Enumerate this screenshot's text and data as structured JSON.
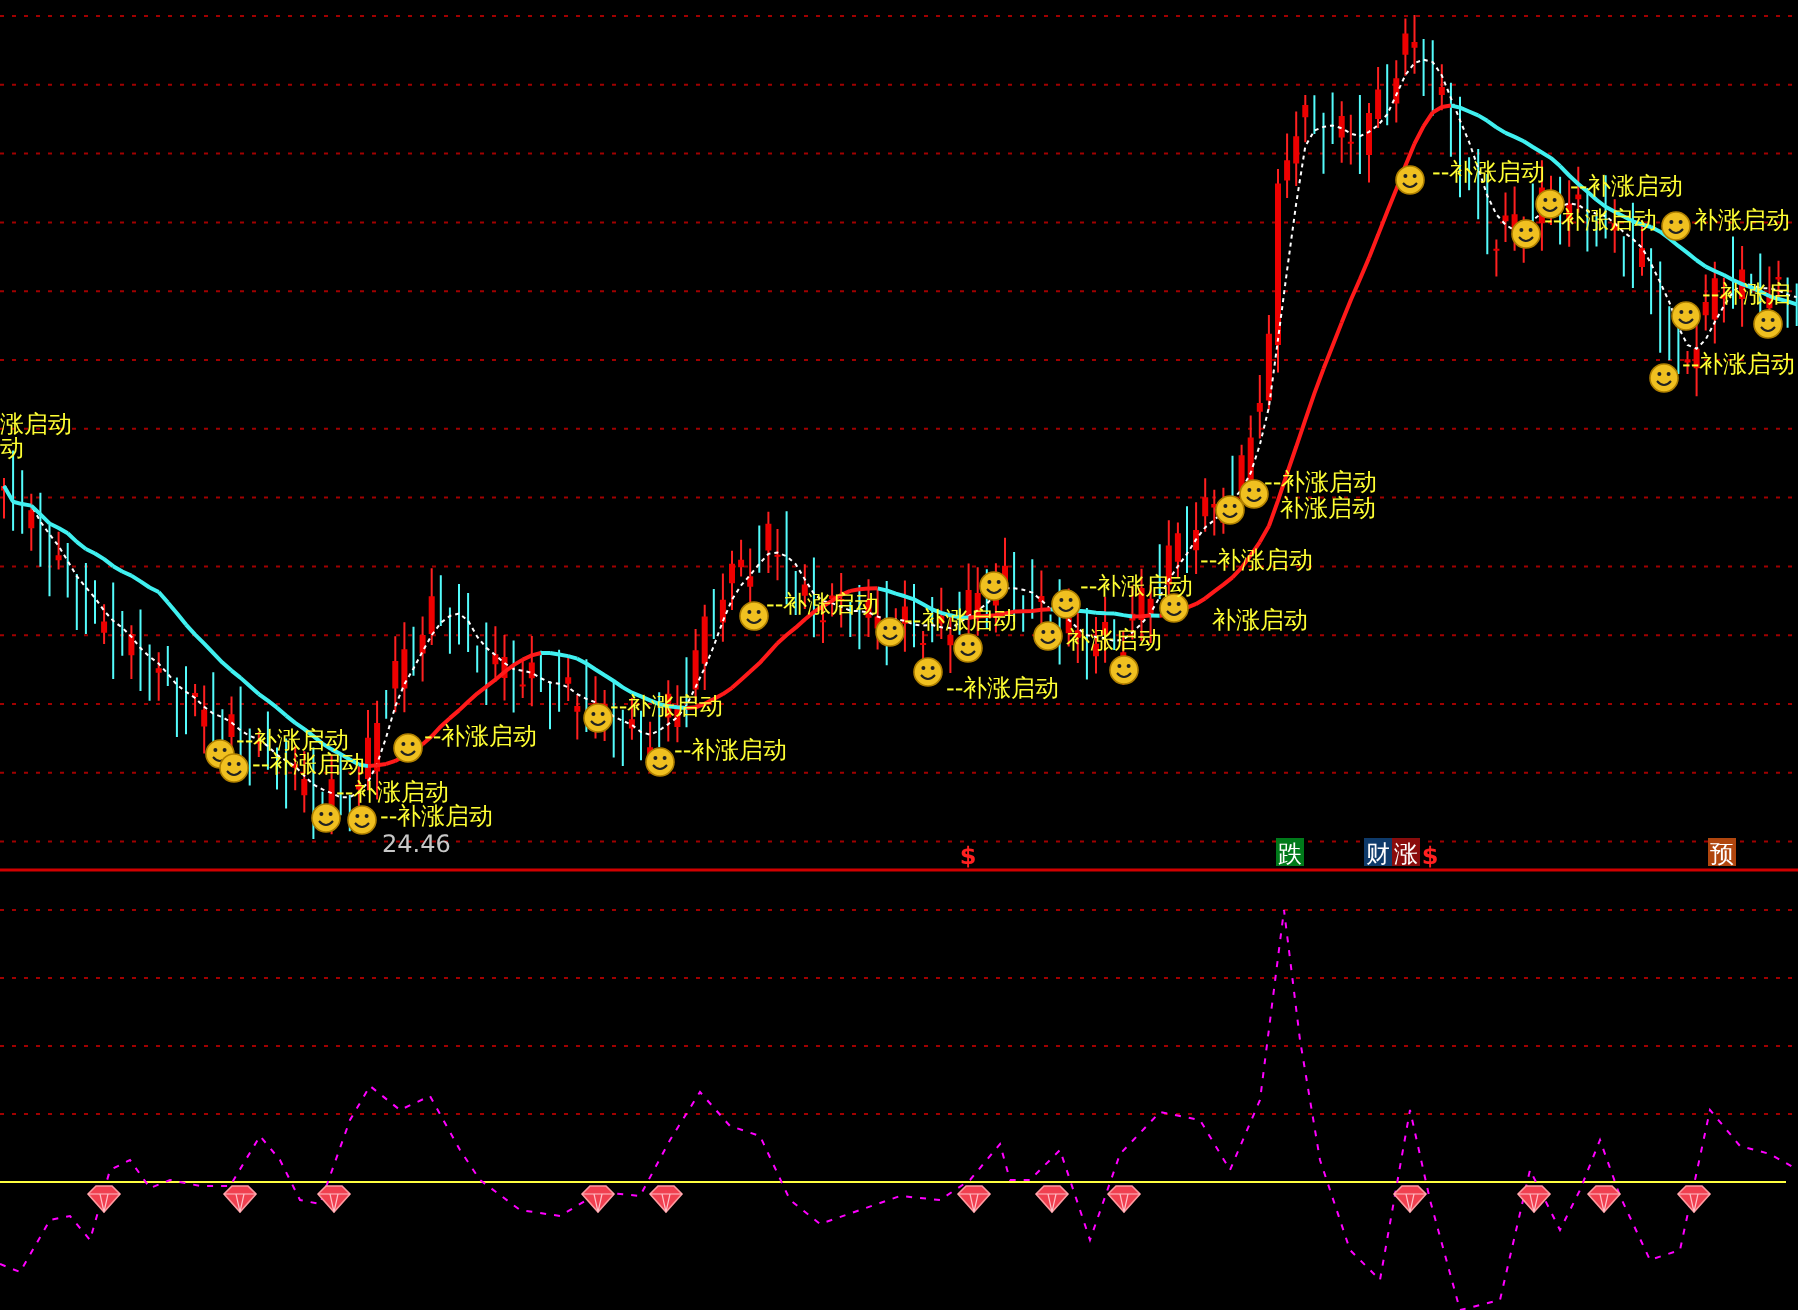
{
  "main_panel": {
    "signal_labels": [
      {
        "text": "--补涨启动"
      },
      {
        "text": "--补涨启动"
      },
      {
        "text": "--补涨启动"
      },
      {
        "text": "补涨启动"
      },
      {
        "text": "--补涨启"
      },
      {
        "text": "--补涨启动"
      },
      {
        "text": "涨启动"
      },
      {
        "text": "动"
      },
      {
        "text": "--补涨启动"
      },
      {
        "text": "补涨启动"
      },
      {
        "text": "--补涨启动"
      },
      {
        "text": "--补涨启动"
      },
      {
        "text": "--补涨启动"
      },
      {
        "text": "--补涨启动"
      },
      {
        "text": "补涨启动"
      },
      {
        "text": "补涨启动"
      },
      {
        "text": "--补涨启动"
      },
      {
        "text": "--补涨启动"
      },
      {
        "text": "--补涨启动"
      },
      {
        "text": "--补涨启动"
      },
      {
        "text": "--补涨启动"
      },
      {
        "text": "--补涨启动"
      },
      {
        "text": "--补涨启动"
      },
      {
        "text": "--补涨启动"
      }
    ],
    "low_price": "24.46"
  },
  "event_markers": [
    {
      "text": "$",
      "kind": "dollar"
    },
    {
      "text": "跌",
      "kind": "badge",
      "color": "#007a1a"
    },
    {
      "text": "财",
      "kind": "badge",
      "color": "#0e3a6a"
    },
    {
      "text": "涨",
      "kind": "badge",
      "color": "#8a0c0c"
    },
    {
      "text": "$",
      "kind": "dollar"
    },
    {
      "text": "预",
      "kind": "badge",
      "color": "#b0460e"
    }
  ]
}
